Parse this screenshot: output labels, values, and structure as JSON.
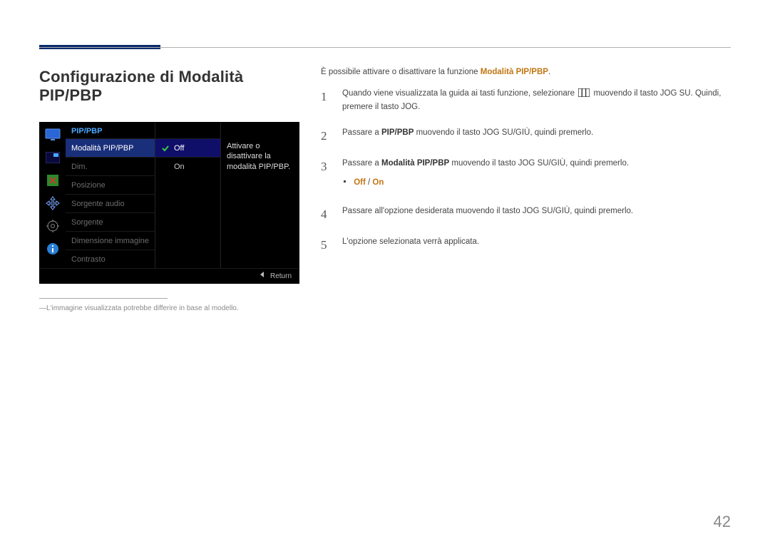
{
  "heading": "Configurazione di Modalità PIP/PBP",
  "osd": {
    "header": "PIP/PBP",
    "menu": [
      "Modalità PIP/PBP",
      "Dim.",
      "Posizione",
      "Sorgente audio",
      "Sorgente",
      "Dimensione immagine",
      "Contrasto"
    ],
    "options": [
      "Off",
      "On"
    ],
    "help": "Attivare o disattivare la modalità PIP/PBP.",
    "footer": "Return"
  },
  "footnote": "L'immagine visualizzata potrebbe differire in base al modello.",
  "intro_pre": "È possibile attivare o disattivare la funzione ",
  "intro_bold": "Modalità PIP/PBP",
  "intro_post": ".",
  "steps": {
    "s1a": "Quando viene visualizzata la guida ai tasti funzione, selezionare ",
    "s1b": " muovendo il tasto JOG SU. Quindi, premere il tasto JOG.",
    "s2a": "Passare a ",
    "s2b": "PIP/PBP",
    "s2c": " muovendo il tasto JOG SU/GIÙ, quindi premerlo.",
    "s3a": "Passare a ",
    "s3b": "Modalità PIP/PBP",
    "s3c": " muovendo il tasto JOG SU/GIÙ, quindi premerlo.",
    "bullet_off": "Off",
    "bullet_sep": " / ",
    "bullet_on": "On",
    "s4": "Passare all'opzione desiderata muovendo il tasto JOG SU/GIÙ, quindi premerlo.",
    "s5": "L'opzione selezionata verrà applicata."
  },
  "page_number": "42"
}
